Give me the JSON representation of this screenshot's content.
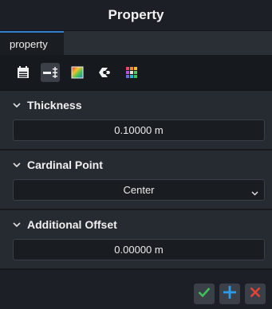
{
  "window": {
    "title": "Property"
  },
  "tabs": [
    {
      "label": "property"
    }
  ],
  "toolbar": {
    "icons": [
      "calendar-icon",
      "align-icon",
      "color-picture-icon",
      "logo-c-icon",
      "color-grid-icon"
    ],
    "active": "align-icon"
  },
  "sections": {
    "thickness": {
      "label": "Thickness",
      "value": "0.10000 m"
    },
    "cardinal": {
      "label": "Cardinal Point",
      "value": "Center"
    },
    "offset": {
      "label": "Additional Offset",
      "value": "0.00000 m"
    }
  },
  "footer": {
    "confirm": "check-icon",
    "add": "plus-icon",
    "cancel": "close-icon"
  },
  "colors": {
    "accent": "#2f7fd0",
    "confirm": "#3fbf5a",
    "add": "#2e9be8",
    "cancel": "#e0443a"
  }
}
